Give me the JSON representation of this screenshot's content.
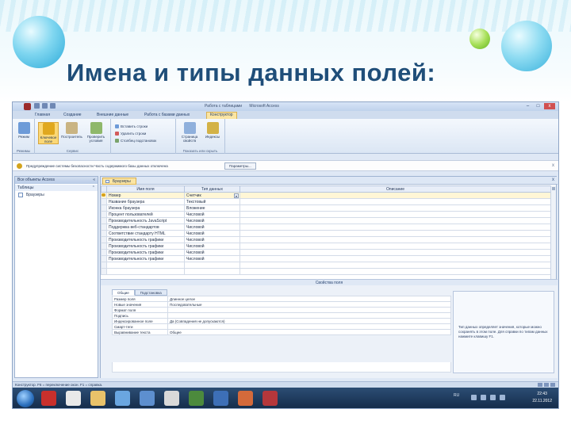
{
  "slide": {
    "title": "Имена и типы данных полей:"
  },
  "window": {
    "title": "Работа с таблицами",
    "title_rest": "Microsoft Access",
    "context_tab": "",
    "minimize": "–",
    "maximize": "□",
    "close": "x"
  },
  "ribbon": {
    "tabs": [
      "Главная",
      "Создание",
      "Внешние данные",
      "Работа с базами данных",
      "Конструктор"
    ],
    "groups": {
      "views": {
        "label": "Режимы",
        "view_button": "Режим"
      },
      "tools": {
        "label": "Сервис",
        "key_button": "Ключевое поле",
        "builder_button": "Построитель",
        "validate_button": "Проверить условия"
      },
      "rows": {
        "insert": "Вставить строки",
        "delete": "Удалить строки",
        "lookup": "Столбец подстановок"
      },
      "show": {
        "label": "Показать или скрыть",
        "props_button": "Страница свойств",
        "index_button": "Индексы"
      }
    }
  },
  "security": {
    "text": "Предупреждение системы безопасности  Часть содержимого базы данных отключена",
    "button": "Параметры...",
    "close": "x"
  },
  "nav": {
    "header": "Все объекты Access",
    "category": "Таблицы",
    "items": [
      "Браузеры"
    ],
    "chevron": "«",
    "cat_chevron": "⌃",
    "toggle": "«"
  },
  "designer": {
    "tab": "Браузеры",
    "close": "x",
    "columns": [
      "Имя поля",
      "Тип данных",
      "Описание"
    ],
    "rows": [
      {
        "name": "Номер",
        "type": "Счетчик",
        "desc": ""
      },
      {
        "name": "Название браузера",
        "type": "Текстовый",
        "desc": ""
      },
      {
        "name": "Иконка браузера",
        "type": "Вложение",
        "desc": ""
      },
      {
        "name": "Процент пользователей",
        "type": "Числовой",
        "desc": ""
      },
      {
        "name": "Производительность JavaScript",
        "type": "Числовой",
        "desc": ""
      },
      {
        "name": "Поддержка веб-стандартов",
        "type": "Числовой",
        "desc": ""
      },
      {
        "name": "Соответствие стандарту HTML",
        "type": "Числовой",
        "desc": ""
      },
      {
        "name": "Производительность графики",
        "type": "Числовой",
        "desc": ""
      },
      {
        "name": "Производительность графики",
        "type": "Числовой",
        "desc": ""
      },
      {
        "name": "Производительность графики",
        "type": "Числовой",
        "desc": ""
      },
      {
        "name": "Производительность графики",
        "type": "Числовой",
        "desc": ""
      },
      {
        "name": "",
        "type": "",
        "desc": ""
      },
      {
        "name": "",
        "type": "",
        "desc": ""
      }
    ],
    "dropdown_glyph": "▾"
  },
  "properties": {
    "label": "Свойства поля",
    "tabs": [
      "Общие",
      "Подстановка"
    ],
    "rows": [
      {
        "key": "Размер поля",
        "value": "Длинное целое"
      },
      {
        "key": "Новые значения",
        "value": "Последовательные"
      },
      {
        "key": "Формат поля",
        "value": ""
      },
      {
        "key": "Подпись",
        "value": ""
      },
      {
        "key": "Индексированное поле",
        "value": "Да (Совпадения не допускаются)"
      },
      {
        "key": "Смарт-теги",
        "value": ""
      },
      {
        "key": "Выравнивание текста",
        "value": "Общее"
      }
    ],
    "help": "Тип данных определяет значения, которые можно сохранять в этом поле. Для справки по типам данных нажмите клавишу F1."
  },
  "status": {
    "text": "Конструктор. F6 = переключение окон. F1 = справка."
  },
  "taskbar": {
    "lang": "RU",
    "time": "22:43",
    "date": "22.11.2012"
  },
  "colors": {
    "title": "#1f4e79",
    "ribbon_accent": "#fbd877",
    "taskbar": "#1c3a5e"
  }
}
